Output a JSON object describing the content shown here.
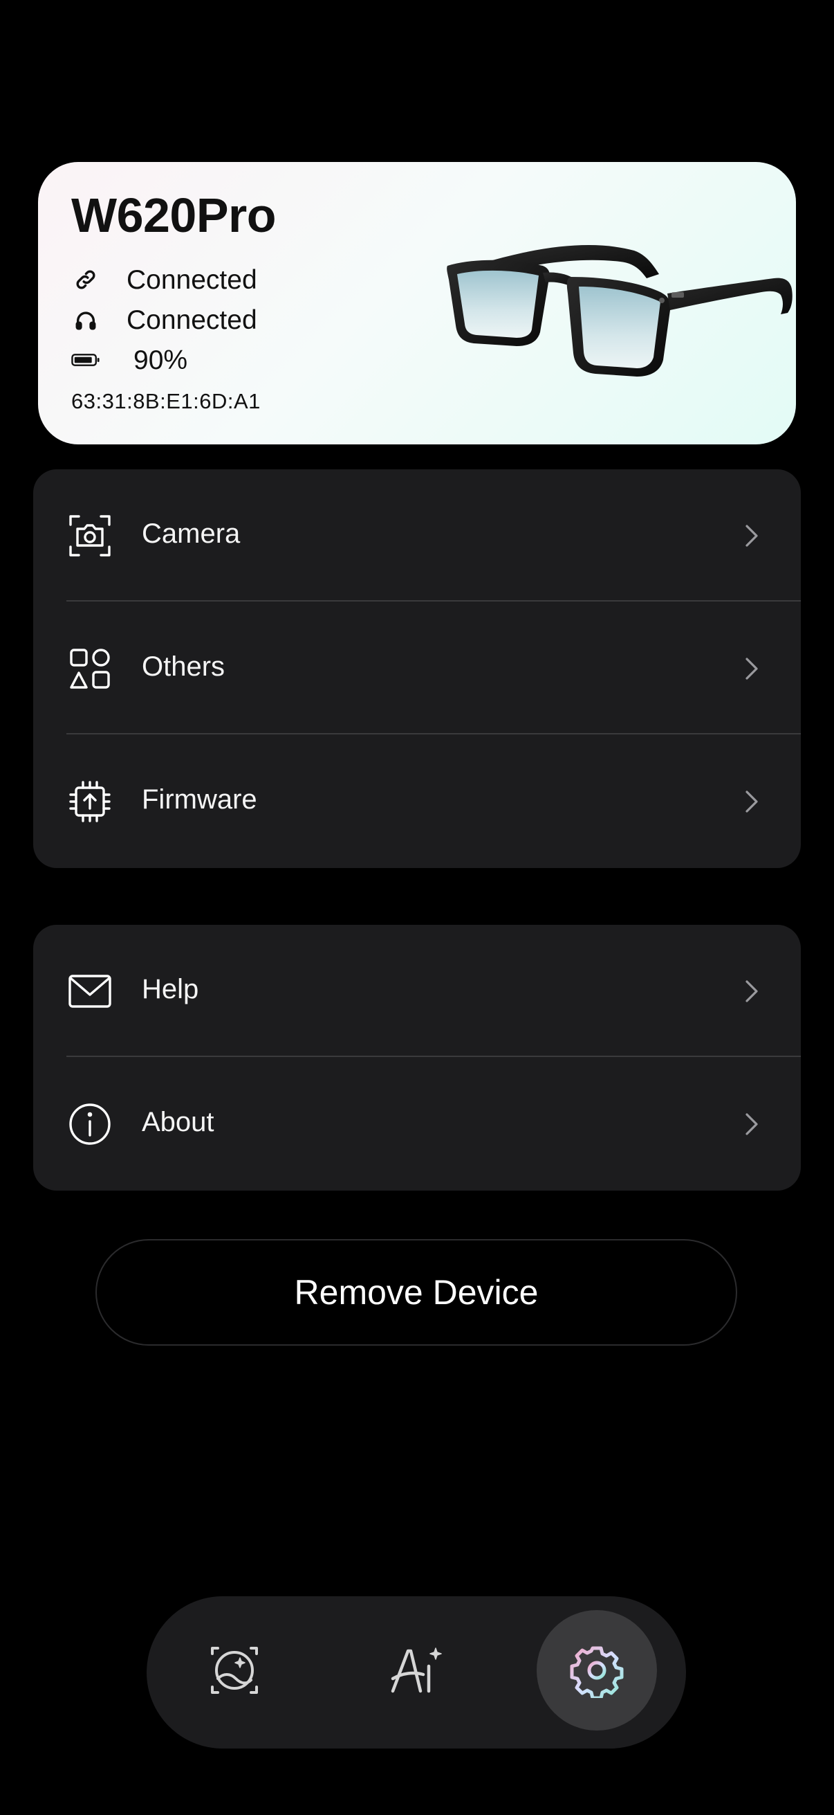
{
  "device": {
    "name": "W620Pro",
    "link_status": "Connected",
    "audio_status": "Connected",
    "battery": "90%",
    "battery_level": 0.9,
    "mac_address": "63:31:8B:E1:6D:A1",
    "icons": {
      "link": "link-icon",
      "audio": "headphones-icon",
      "battery": "battery-icon",
      "product": "smart-glasses-image"
    }
  },
  "menu_group_1": {
    "items": [
      {
        "label": "Camera",
        "icon": "camera-icon"
      },
      {
        "label": "Others",
        "icon": "grid-shapes-icon"
      },
      {
        "label": "Firmware",
        "icon": "firmware-chip-icon"
      }
    ]
  },
  "menu_group_2": {
    "items": [
      {
        "label": "Help",
        "icon": "mail-icon"
      },
      {
        "label": "About",
        "icon": "info-icon"
      }
    ]
  },
  "remove_button": {
    "label": "Remove Device"
  },
  "tab_bar": {
    "tabs": [
      {
        "icon": "gallery-icon",
        "selected": false
      },
      {
        "icon": "ai-icon",
        "selected": false
      },
      {
        "icon": "settings-gear-icon",
        "selected": true
      }
    ]
  },
  "colors": {
    "background": "#000000",
    "card_surface": "#1c1c1e",
    "divider": "#3a3a3c",
    "selected_tab": "#3a3a3c",
    "device_card_gradient_start": "#fbf3f6",
    "device_card_gradient_end": "#e3fbf6"
  }
}
